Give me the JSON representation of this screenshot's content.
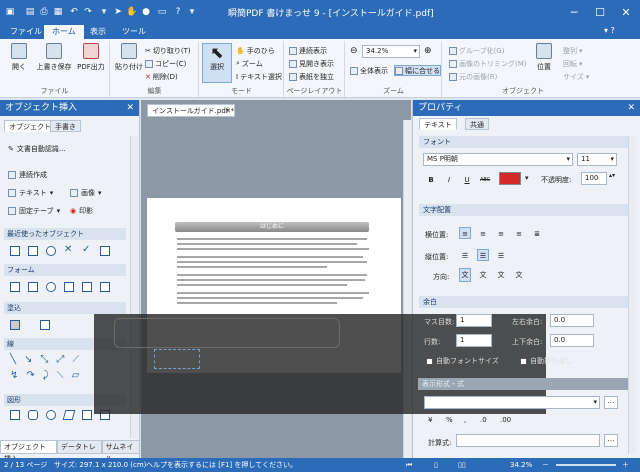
{
  "window": {
    "title": "瞬簡PDF 書けまっせ 9 - [インストールガイド.pdf]"
  },
  "quick_access": {
    "icons": [
      "save-icon",
      "print-icon",
      "grid-icon",
      "undo-icon",
      "redo-icon",
      "pointer-icon",
      "hand-icon",
      "circle-icon",
      "window-icon",
      "help-icon",
      "dropdown-icon"
    ]
  },
  "window_buttons": {
    "minimize": "─",
    "maximize": "☐",
    "close": "✕"
  },
  "ribbon_tabs": [
    "ファイル",
    "ホーム",
    "表示",
    "ツール"
  ],
  "ribbon": {
    "file": {
      "open": "開く",
      "overwrite_save": "上書き保存",
      "pdf_output": "PDF出力",
      "label": "ファイル"
    },
    "edit": {
      "paste": "貼り付け",
      "cut": "切り取り(T)",
      "copy": "コピー(C)",
      "delete": "削除(D)",
      "label": "編集"
    },
    "mode": {
      "select": "選択",
      "hand": "手のひら",
      "zoom": "ズーム",
      "text_select": "テキスト選択",
      "label": "モード"
    },
    "layout": {
      "continuous": "連続表示",
      "facing": "見開き表示",
      "independent": "表紙を独立",
      "label": "ページレイアウト"
    },
    "zoom": {
      "value": "34.2%",
      "whole_page": "全体表示",
      "fit_width": "幅に合せる",
      "label": "ズーム"
    },
    "object": {
      "group": "グループ化(G)",
      "trim_image": "画像のトリミング(M)",
      "cancel_trim": "元の画像(R)",
      "position": "位置",
      "align": "整列",
      "rotate": "回転",
      "size": "サイズ",
      "label": "オブジェクト"
    }
  },
  "left_panel": {
    "title": "オブジェクト挿入",
    "tabs": [
      "オブジェクト",
      "手書き"
    ],
    "auto_text": "文書自動認識...",
    "continuous_create": "連続作成",
    "text_btn": "テキスト",
    "image_btn": "画像",
    "fixed_text": "固定テーブ",
    "stamp": "印影",
    "sections": [
      "最近使ったオブジェクト",
      "フォーム",
      "塗込",
      "線",
      "図形"
    ],
    "bottom_tabs": [
      "オブジェクト挿入",
      "データトレー",
      "サムネイル"
    ]
  },
  "doc": {
    "tab_label": "インストールガイド.pdf *",
    "page_heading": "はじめに"
  },
  "right_panel": {
    "title": "プロパティ",
    "tabs": [
      "テキスト",
      "共通"
    ],
    "font_section": "フォント",
    "font_name": "MS P明朝",
    "font_size": "11",
    "bold": "B",
    "italic": "I",
    "underline": "U",
    "strike": "ABC",
    "opacity_label": "不透明度:",
    "opacity_value": "100",
    "align_section": "文字配置",
    "horizontal_label": "横位置:",
    "vertical_label": "縦位置:",
    "direction_label": "方向:",
    "margin_section": "余白",
    "margin_top_label": "マス目数:",
    "margin_top_value": "1",
    "lines_label": "行数:",
    "lines_value": "1",
    "left_right_label": "左右余白:",
    "left_right_value": "0.0",
    "top_bottom_label": "上下余白:",
    "top_bottom_value": "0.0",
    "auto_font_size": "自動フォントサイズ",
    "auto_wrap": "自動折り返し",
    "format_section": "表示形式・式",
    "format_symbols": [
      "¥",
      "%",
      ",",
      ".0",
      ".00"
    ],
    "formula_label": "計算式:"
  },
  "status": {
    "page": "2 / 13 ページ",
    "size": "サイズ: 297.1 x 210.0 (cm)",
    "help": "ヘルプを表示するには [F1] を押してください。",
    "zoom": "34.2%"
  },
  "colors": {
    "accent": "#2b6bb7",
    "font_color": "#d42a2a"
  }
}
